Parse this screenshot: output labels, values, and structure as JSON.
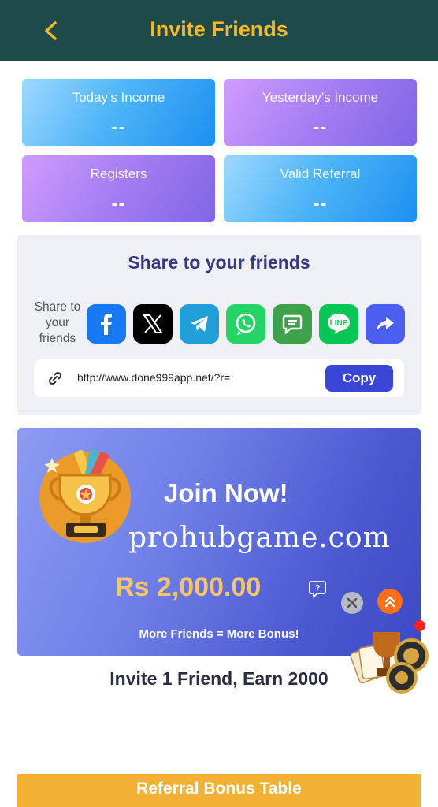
{
  "header": {
    "title": "Invite Friends"
  },
  "stats": [
    {
      "label": "Today's Income",
      "value": "--"
    },
    {
      "label": "Yesterday's Income",
      "value": "--"
    },
    {
      "label": "Registers",
      "value": "--"
    },
    {
      "label": "Valid Referral",
      "value": "--"
    }
  ],
  "share": {
    "title": "Share to your friends",
    "label": "Share to your friends",
    "icons": [
      "facebook-icon",
      "x-icon",
      "telegram-icon",
      "whatsapp-icon",
      "sms-icon",
      "line-icon",
      "more-share-icon"
    ],
    "icon_colors": [
      "#1877f2",
      "#000000",
      "#229ed9",
      "#25d366",
      "#3fa24a",
      "#06c755",
      "#4a5ef0"
    ],
    "line_text": "LINE",
    "link": "http://www.done999app.net/?r=",
    "copy_label": "Copy"
  },
  "banner": {
    "headline": "Join Now!",
    "watermark": "prohubgame.com",
    "amount": "Rs 2,000.00",
    "tagline": "More Friends = More Bonus!",
    "accent": "#f6c46a"
  },
  "invite_text": "Invite 1 Friend, Earn 2000",
  "table_title": "Referral Bonus Table",
  "colors": {
    "header_bg": "#1e4b4a",
    "title": "#f5b92a",
    "copy_button": "#3a46d6",
    "table_bar": "#f0b135"
  }
}
